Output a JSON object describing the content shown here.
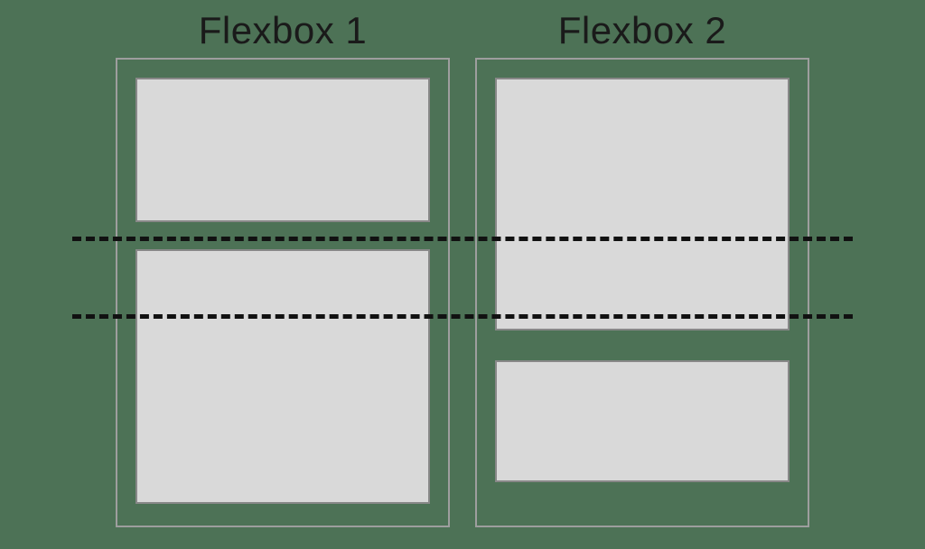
{
  "diagram": {
    "left_title": "Flexbox 1",
    "right_title": "Flexbox 2"
  }
}
